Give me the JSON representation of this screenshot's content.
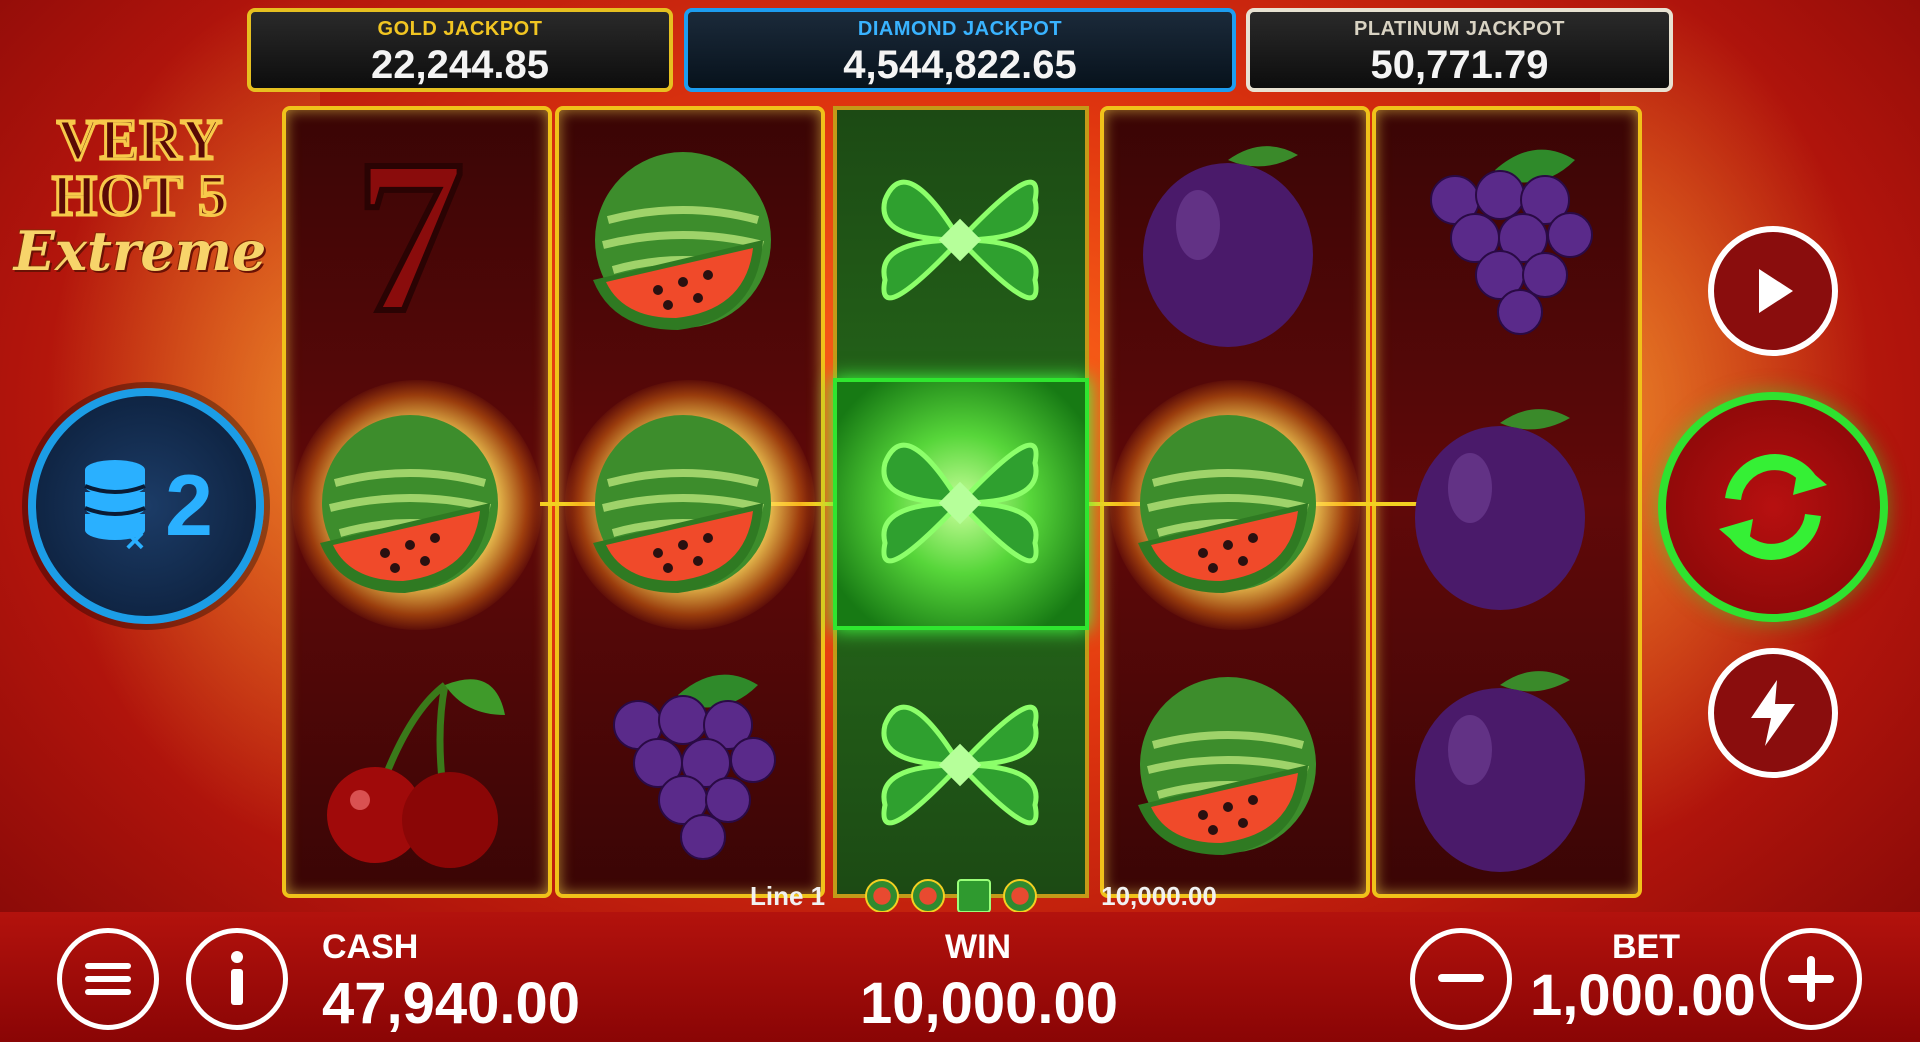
{
  "jackpots": [
    {
      "label": "GOLD JACKPOT",
      "value": "22,244.85"
    },
    {
      "label": "DIAMOND JACKPOT",
      "value": "4,544,822.65"
    },
    {
      "label": "PLATINUM JACKPOT",
      "value": "50,771.79"
    }
  ],
  "logo": {
    "line1": "VERY",
    "line2": "HOT 5",
    "line3": "Extreme"
  },
  "multiplier": {
    "label": "2"
  },
  "reels": [
    [
      "seven",
      "watermelon",
      "cherries"
    ],
    [
      "watermelon",
      "watermelon",
      "grapes"
    ],
    [
      "clover",
      "clover",
      "clover"
    ],
    [
      "plum",
      "watermelon",
      "watermelon"
    ],
    [
      "grapes",
      "plum",
      "plum"
    ]
  ],
  "line_win": {
    "label": "Line 1",
    "symbols": [
      "watermelon",
      "watermelon",
      "clover",
      "watermelon"
    ],
    "amount": "10,000.00"
  },
  "cash": {
    "label": "CASH",
    "value": "47,940.00"
  },
  "win": {
    "label": "WIN",
    "value": "10,000.00"
  },
  "bet": {
    "label": "BET",
    "value": "1,000.00"
  },
  "buttons": {
    "menu": "menu-icon",
    "info": "info-icon",
    "play": "play-icon",
    "spin": "spin-icon",
    "turbo": "lightning-icon",
    "bet_minus": "minus-icon",
    "bet_plus": "plus-icon"
  },
  "colors": {
    "gold": "#f1c522",
    "diamond": "#1d9df0",
    "platinum": "#e8e2d2",
    "spin": "#2fe22f"
  }
}
